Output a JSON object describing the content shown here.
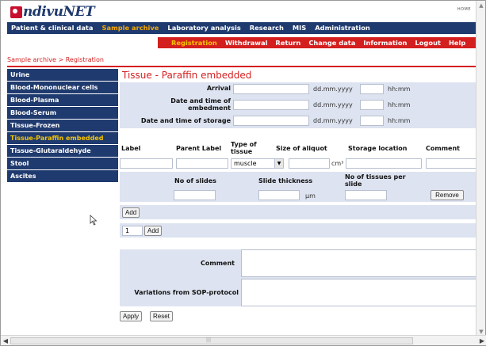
{
  "app": {
    "logo_text": "ndivuNET",
    "home_label": "HOME"
  },
  "main_nav": [
    {
      "label": "Patient & clinical data",
      "active": false
    },
    {
      "label": "Sample archive",
      "active": true
    },
    {
      "label": "Laboratory analysis",
      "active": false
    },
    {
      "label": "Research",
      "active": false
    },
    {
      "label": "MIS",
      "active": false
    },
    {
      "label": "Administration",
      "active": false
    }
  ],
  "sub_nav": [
    {
      "label": "Registration",
      "active": true
    },
    {
      "label": "Withdrawal",
      "active": false
    },
    {
      "label": "Return",
      "active": false
    },
    {
      "label": "Change data",
      "active": false
    },
    {
      "label": "Information",
      "active": false
    },
    {
      "label": "Logout",
      "active": false
    },
    {
      "label": "Help",
      "active": false
    }
  ],
  "breadcrumb": "Sample archive > Registration",
  "sidebar": [
    {
      "label": "Urine",
      "active": false
    },
    {
      "label": "Blood-Mononuclear cells",
      "active": false
    },
    {
      "label": "Blood-Plasma",
      "active": false
    },
    {
      "label": "Blood-Serum",
      "active": false
    },
    {
      "label": "Tissue-Frozen",
      "active": false
    },
    {
      "label": "Tissue-Paraffin embedded",
      "active": true
    },
    {
      "label": "Tissue-Glutaraldehyde",
      "active": false
    },
    {
      "label": "Stool",
      "active": false
    },
    {
      "label": "Ascites",
      "active": false
    }
  ],
  "form": {
    "title": "Tissue - Paraffin embedded",
    "arrival_label": "Arrival",
    "date_time_embedment_label": "Date and time of embedment",
    "date_time_storage_label": "Date and time of storage",
    "date_hint": "dd.mm.yyyy",
    "time_hint": "hh:mm",
    "columns": {
      "label": "Label",
      "parent_label": "Parent Label",
      "type_of_tissue": "Type of tissue",
      "size_of_aliquot": "Size of aliquot",
      "storage_location": "Storage location",
      "comment": "Comment"
    },
    "tissue_type_value": "muscle",
    "size_unit": "cm³",
    "slides": {
      "no_of_slides": "No of slides",
      "slide_thickness": "Slide thickness",
      "no_tissues_per_slide": "No of tissues per slide",
      "thickness_unit": "µm",
      "remove_label": "Remove"
    },
    "add_label": "Add",
    "add_count_value": "1",
    "add_count_button": "Add",
    "comment_label": "Comment",
    "variations_label": "Variations from SOP-protocol",
    "apply_label": "Apply",
    "reset_label": "Reset"
  },
  "colors": {
    "navy": "#1f3a6e",
    "red": "#d41f1f",
    "orange": "#f6a800",
    "band": "#dde3f0"
  }
}
